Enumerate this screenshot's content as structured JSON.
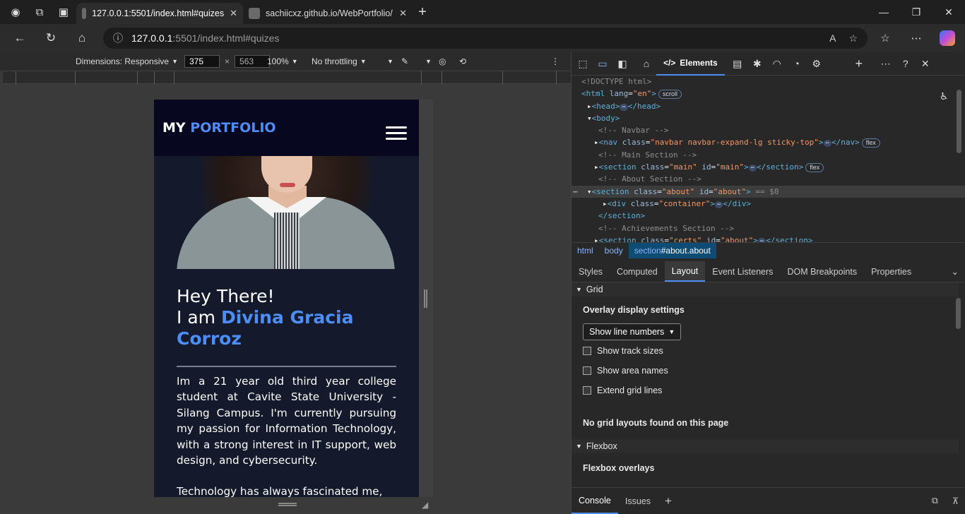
{
  "browser": {
    "tabs": [
      {
        "label": "127.0.0.1:5501/index.html#quizes",
        "active": true
      },
      {
        "label": "sachiicxz.github.io/WebPortfolio/",
        "active": false
      }
    ],
    "url_host": "127.0.0.1",
    "url_rest": ":5501/index.html#quizes"
  },
  "device_toolbar": {
    "dimensions_label": "Dimensions: Responsive",
    "width": "375",
    "height": "563",
    "zoom": "100%",
    "throttling": "No throttling"
  },
  "page": {
    "brand_prefix": "MY",
    "brand_accent": "PORTFOLIO",
    "greeting": "Hey There!",
    "intro": "I am",
    "name": "Divina Gracia Corroz",
    "bio_1": "Im a 21 year old third year college student at Cavite State University - Silang Campus. I'm currently pursuing my passion for Information Technology, with a strong interest in IT support, web design, and cybersecurity.",
    "bio_2": "Technology has always fascinated me,"
  },
  "devtools": {
    "elements_tab": "Elements",
    "dom": {
      "doctype": "<!DOCTYPE html>",
      "html_tag": "html",
      "html_attr": "lang",
      "html_val": "\"en\"",
      "scroll_badge": "scroll",
      "head": "head",
      "body": "body",
      "c_navbar": "<!-- Navbar -->",
      "nav_attr": "\"navbar navbar-expand-lg sticky-top\"",
      "flex_badge": "flex",
      "c_main": "<!-- Main Section -->",
      "main_class": "\"main\"",
      "main_id": "\"main\"",
      "c_about": "<!--  About Section -->",
      "about_class": "\"about\"",
      "about_id": "\"about\"",
      "eq": "== $0",
      "container_class": "\"container\"",
      "section_close": "</section>",
      "c_ach": "<!--  Achievements Section -->",
      "certs_class": "\"certs\"",
      "certs_id": "\"about\""
    },
    "crumbs": [
      "html",
      "body"
    ],
    "crumb_current_tag": "section",
    "crumb_current_rest": "#about.about",
    "subtabs": [
      "Styles",
      "Computed",
      "Layout",
      "Event Listeners",
      "DOM Breakpoints",
      "Properties"
    ],
    "layout": {
      "grid_header": "Grid",
      "overlay_title": "Overlay display settings",
      "select_value": "Show line numbers",
      "checks": [
        "Show track sizes",
        "Show area names",
        "Extend grid lines"
      ],
      "no_grid": "No grid layouts found on this page",
      "flex_header": "Flexbox",
      "flex_overlays": "Flexbox overlays"
    },
    "bottom_tabs": [
      "Console",
      "Issues"
    ]
  }
}
